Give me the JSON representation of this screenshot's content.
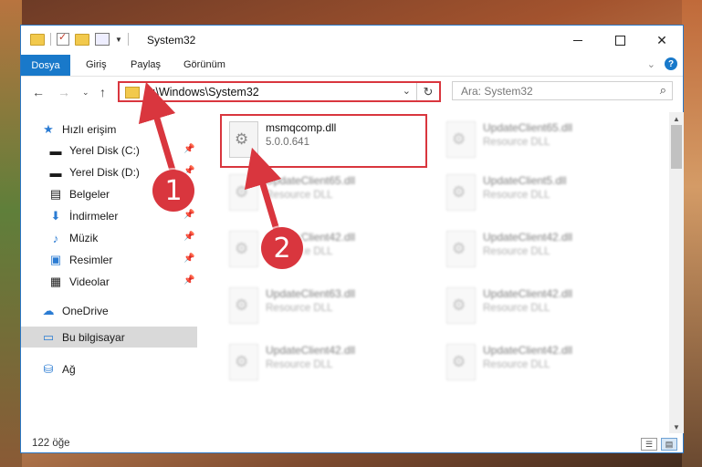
{
  "window": {
    "title": "System32"
  },
  "ribbon": {
    "tabs": [
      "Dosya",
      "Giriş",
      "Paylaş",
      "Görünüm"
    ]
  },
  "navbar": {
    "address": "C:\\Windows\\System32",
    "search_placeholder": "Ara: System32"
  },
  "sidebar": {
    "items": [
      {
        "label": "Hızlı erişim",
        "icon": "star-icon"
      },
      {
        "label": "Yerel Disk (C:)",
        "icon": "drive-icon",
        "pinned": true
      },
      {
        "label": "Yerel Disk (D:)",
        "icon": "drive-icon",
        "pinned": true
      },
      {
        "label": "Belgeler",
        "icon": "documents-icon",
        "pinned": true
      },
      {
        "label": "İndirmeler",
        "icon": "download-icon",
        "pinned": true
      },
      {
        "label": "Müzik",
        "icon": "music-icon",
        "pinned": true
      },
      {
        "label": "Resimler",
        "icon": "pictures-icon",
        "pinned": true
      },
      {
        "label": "Videolar",
        "icon": "videos-icon",
        "pinned": true
      },
      {
        "label": "OneDrive",
        "icon": "cloud-icon"
      },
      {
        "label": "Bu bilgisayar",
        "icon": "computer-icon",
        "selected": true
      },
      {
        "label": "Ağ",
        "icon": "network-icon"
      }
    ]
  },
  "files": [
    {
      "name": "msmqcomp.dll",
      "desc": "5.0.0.641",
      "highlighted": true
    },
    {
      "name": "UpdateClient65.dll",
      "desc": "Resource DLL"
    },
    {
      "name": "UpdateClient65.dll",
      "desc": "Resource DLL"
    },
    {
      "name": "UpdateClient5.dll",
      "desc": "Resource DLL"
    },
    {
      "name": "UpdateClient42.dll",
      "desc": "Resource DLL"
    },
    {
      "name": "UpdateClient42.dll",
      "desc": "Resource DLL"
    },
    {
      "name": "UpdateClient63.dll",
      "desc": "Resource DLL"
    },
    {
      "name": "UpdateClient42.dll",
      "desc": "Resource DLL"
    },
    {
      "name": "UpdateClient42.dll",
      "desc": "Resource DLL"
    },
    {
      "name": "UpdateClient42.dll",
      "desc": "Resource DLL"
    }
  ],
  "status": {
    "count": "122 öğe"
  },
  "annotations": [
    "1",
    "2"
  ],
  "colors": {
    "accent": "#1979ca",
    "highlight": "#d9363e"
  }
}
